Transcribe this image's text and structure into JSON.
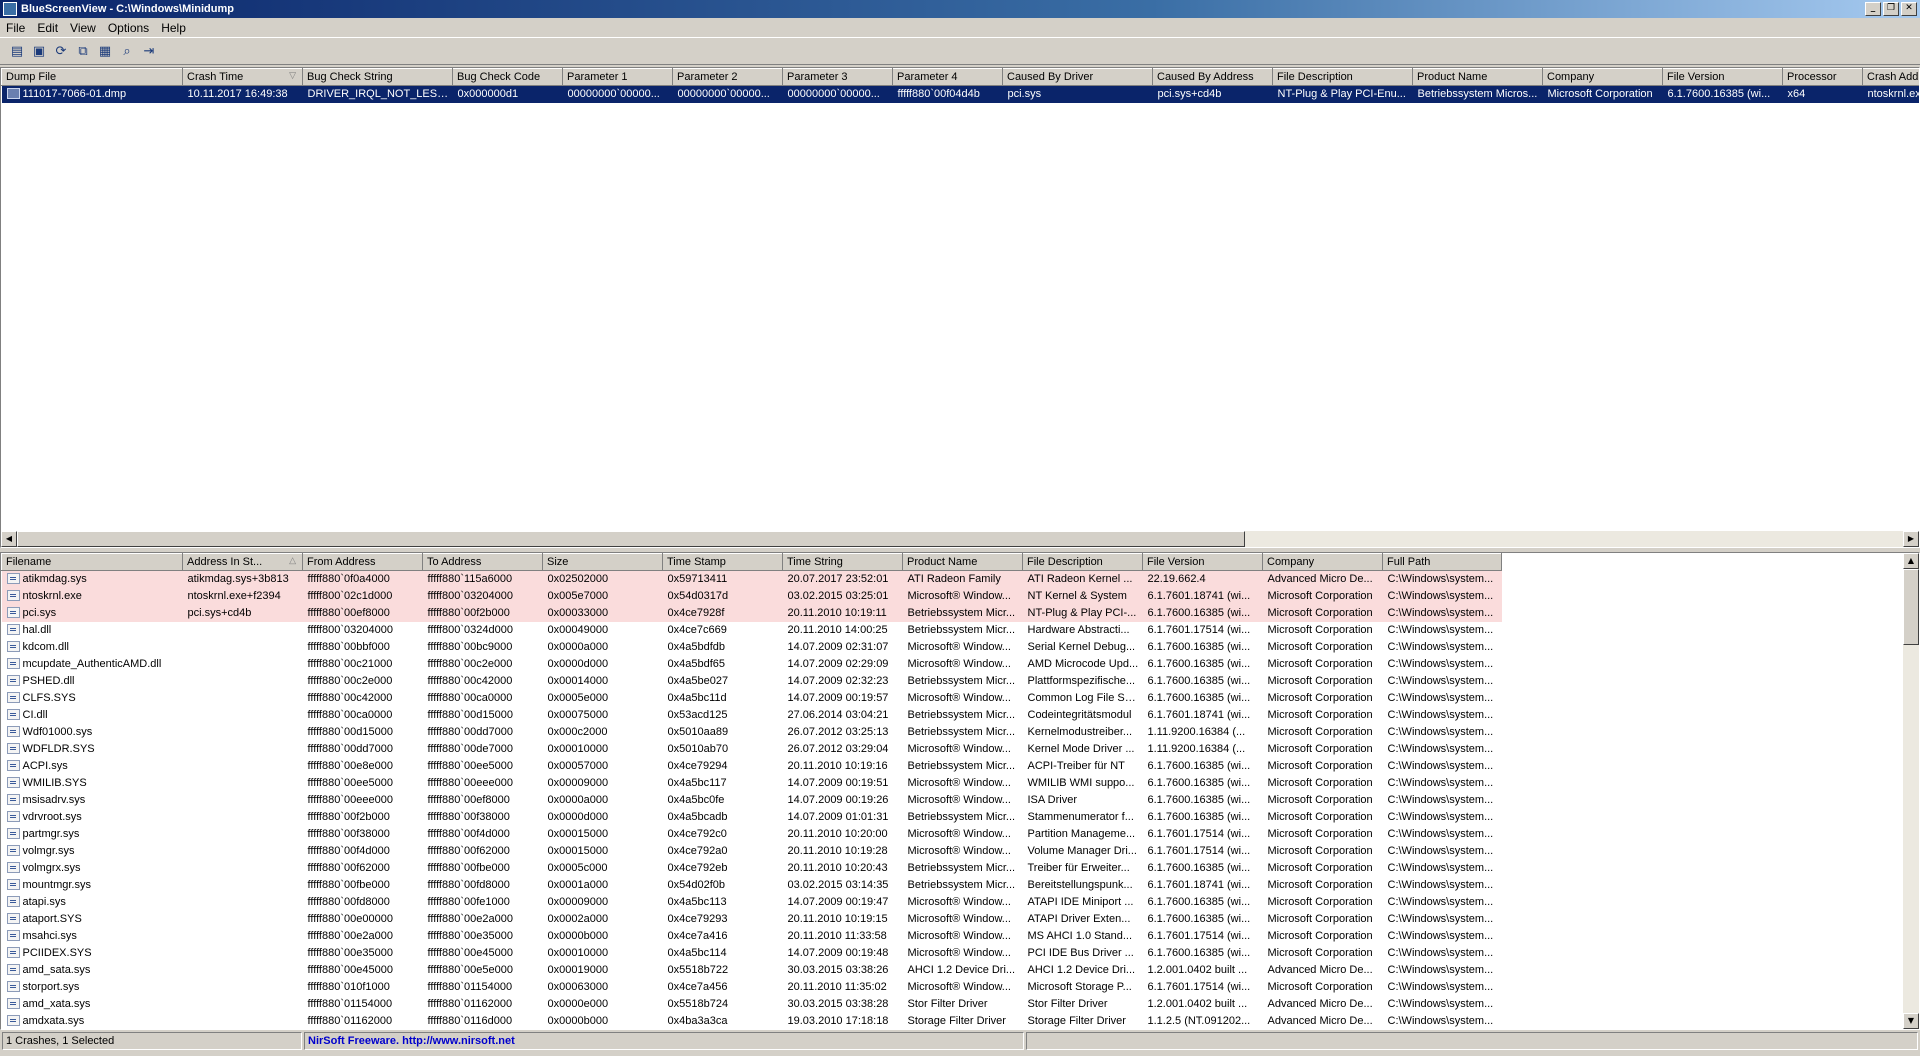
{
  "window": {
    "title": "BlueScreenView  -  C:\\Windows\\Minidump"
  },
  "menu": [
    "File",
    "Edit",
    "View",
    "Options",
    "Help"
  ],
  "toolbar": {
    "icons": [
      "properties-icon",
      "save-icon",
      "refresh-icon",
      "copy-icon",
      "html-report-icon",
      "find-icon",
      "exit-icon"
    ]
  },
  "crash_table": {
    "columns": [
      "Dump File",
      "Crash Time",
      "Bug Check String",
      "Bug Check Code",
      "Parameter 1",
      "Parameter 2",
      "Parameter 3",
      "Parameter 4",
      "Caused By Driver",
      "Caused By Address",
      "File Description",
      "Product Name",
      "Company",
      "File Version",
      "Processor",
      "Crash Addr"
    ],
    "rows": [
      [
        "111017-7066-01.dmp",
        "10.11.2017 16:49:38",
        "DRIVER_IRQL_NOT_LESS...",
        "0x000000d1",
        "00000000`00000...",
        "00000000`00000...",
        "00000000`00000...",
        "fffff880`00f04d4b",
        "pci.sys",
        "pci.sys+cd4b",
        "NT-Plug & Play PCI-Enu...",
        "Betriebssystem Micros...",
        "Microsoft Corporation",
        "6.1.7600.16385 (wi...",
        "x64",
        "ntoskrnl.ex"
      ]
    ]
  },
  "driver_table": {
    "columns": [
      "Filename",
      "Address In St...",
      "From Address",
      "To Address",
      "Size",
      "Time Stamp",
      "Time String",
      "Product Name",
      "File Description",
      "File Version",
      "Company",
      "Full Path"
    ],
    "rows": [
      [
        "atikmdag.sys",
        "atikmdag.sys+3b813",
        "fffff880`0f0a4000",
        "fffff880`115a6000",
        "0x02502000",
        "0x59713411",
        "20.07.2017 23:52:01",
        "ATI Radeon Family",
        "ATI Radeon Kernel ...",
        "22.19.662.4",
        "Advanced Micro De...",
        "C:\\Windows\\system..."
      ],
      [
        "ntoskrnl.exe",
        "ntoskrnl.exe+f2394",
        "fffff800`02c1d000",
        "fffff800`03204000",
        "0x005e7000",
        "0x54d0317d",
        "03.02.2015 03:25:01",
        "Microsoft® Window...",
        "NT Kernel & System",
        "6.1.7601.18741 (wi...",
        "Microsoft Corporation",
        "C:\\Windows\\system..."
      ],
      [
        "pci.sys",
        "pci.sys+cd4b",
        "fffff880`00ef8000",
        "fffff880`00f2b000",
        "0x00033000",
        "0x4ce7928f",
        "20.11.2010 10:19:11",
        "Betriebssystem Micr...",
        "NT-Plug & Play PCI-...",
        "6.1.7600.16385 (wi...",
        "Microsoft Corporation",
        "C:\\Windows\\system..."
      ],
      [
        "hal.dll",
        "",
        "fffff800`03204000",
        "fffff800`0324d000",
        "0x00049000",
        "0x4ce7c669",
        "20.11.2010 14:00:25",
        "Betriebssystem Micr...",
        "Hardware Abstracti...",
        "6.1.7601.17514 (wi...",
        "Microsoft Corporation",
        "C:\\Windows\\system..."
      ],
      [
        "kdcom.dll",
        "",
        "fffff880`00bbf000",
        "fffff880`00bc9000",
        "0x0000a000",
        "0x4a5bdfdb",
        "14.07.2009 02:31:07",
        "Microsoft® Window...",
        "Serial Kernel Debug...",
        "6.1.7600.16385 (wi...",
        "Microsoft Corporation",
        "C:\\Windows\\system..."
      ],
      [
        "mcupdate_AuthenticAMD.dll",
        "",
        "fffff880`00c21000",
        "fffff880`00c2e000",
        "0x0000d000",
        "0x4a5bdf65",
        "14.07.2009 02:29:09",
        "Microsoft® Window...",
        "AMD Microcode Upd...",
        "6.1.7600.16385 (wi...",
        "Microsoft Corporation",
        "C:\\Windows\\system..."
      ],
      [
        "PSHED.dll",
        "",
        "fffff880`00c2e000",
        "fffff880`00c42000",
        "0x00014000",
        "0x4a5be027",
        "14.07.2009 02:32:23",
        "Betriebssystem Micr...",
        "Plattformspezifische...",
        "6.1.7600.16385 (wi...",
        "Microsoft Corporation",
        "C:\\Windows\\system..."
      ],
      [
        "CLFS.SYS",
        "",
        "fffff880`00c42000",
        "fffff880`00ca0000",
        "0x0005e000",
        "0x4a5bc11d",
        "14.07.2009 00:19:57",
        "Microsoft® Window...",
        "Common Log File Sy...",
        "6.1.7600.16385 (wi...",
        "Microsoft Corporation",
        "C:\\Windows\\system..."
      ],
      [
        "CI.dll",
        "",
        "fffff880`00ca0000",
        "fffff880`00d15000",
        "0x00075000",
        "0x53acd125",
        "27.06.2014 03:04:21",
        "Betriebssystem Micr...",
        "Codeintegritätsmodul",
        "6.1.7601.18741 (wi...",
        "Microsoft Corporation",
        "C:\\Windows\\system..."
      ],
      [
        "Wdf01000.sys",
        "",
        "fffff880`00d15000",
        "fffff880`00dd7000",
        "0x000c2000",
        "0x5010aa89",
        "26.07.2012 03:25:13",
        "Betriebssystem Micr...",
        "Kernelmodustreiber...",
        "1.11.9200.16384 (...",
        "Microsoft Corporation",
        "C:\\Windows\\system..."
      ],
      [
        "WDFLDR.SYS",
        "",
        "fffff880`00dd7000",
        "fffff880`00de7000",
        "0x00010000",
        "0x5010ab70",
        "26.07.2012 03:29:04",
        "Microsoft® Window...",
        "Kernel Mode Driver ...",
        "1.11.9200.16384 (...",
        "Microsoft Corporation",
        "C:\\Windows\\system..."
      ],
      [
        "ACPI.sys",
        "",
        "fffff880`00e8e000",
        "fffff880`00ee5000",
        "0x00057000",
        "0x4ce79294",
        "20.11.2010 10:19:16",
        "Betriebssystem Micr...",
        "ACPI-Treiber für NT",
        "6.1.7600.16385 (wi...",
        "Microsoft Corporation",
        "C:\\Windows\\system..."
      ],
      [
        "WMILIB.SYS",
        "",
        "fffff880`00ee5000",
        "fffff880`00eee000",
        "0x00009000",
        "0x4a5bc117",
        "14.07.2009 00:19:51",
        "Microsoft® Window...",
        "WMILIB WMI suppo...",
        "6.1.7600.16385 (wi...",
        "Microsoft Corporation",
        "C:\\Windows\\system..."
      ],
      [
        "msisadrv.sys",
        "",
        "fffff880`00eee000",
        "fffff880`00ef8000",
        "0x0000a000",
        "0x4a5bc0fe",
        "14.07.2009 00:19:26",
        "Microsoft® Window...",
        "ISA Driver",
        "6.1.7600.16385 (wi...",
        "Microsoft Corporation",
        "C:\\Windows\\system..."
      ],
      [
        "vdrvroot.sys",
        "",
        "fffff880`00f2b000",
        "fffff880`00f38000",
        "0x0000d000",
        "0x4a5bcadb",
        "14.07.2009 01:01:31",
        "Betriebssystem Micr...",
        "Stammenumerator f...",
        "6.1.7600.16385 (wi...",
        "Microsoft Corporation",
        "C:\\Windows\\system..."
      ],
      [
        "partmgr.sys",
        "",
        "fffff880`00f38000",
        "fffff880`00f4d000",
        "0x00015000",
        "0x4ce792c0",
        "20.11.2010 10:20:00",
        "Microsoft® Window...",
        "Partition Manageme...",
        "6.1.7601.17514 (wi...",
        "Microsoft Corporation",
        "C:\\Windows\\system..."
      ],
      [
        "volmgr.sys",
        "",
        "fffff880`00f4d000",
        "fffff880`00f62000",
        "0x00015000",
        "0x4ce792a0",
        "20.11.2010 10:19:28",
        "Microsoft® Window...",
        "Volume Manager Dri...",
        "6.1.7601.17514 (wi...",
        "Microsoft Corporation",
        "C:\\Windows\\system..."
      ],
      [
        "volmgrx.sys",
        "",
        "fffff880`00f62000",
        "fffff880`00fbe000",
        "0x0005c000",
        "0x4ce792eb",
        "20.11.2010 10:20:43",
        "Betriebssystem Micr...",
        "Treiber für Erweiter...",
        "6.1.7600.16385 (wi...",
        "Microsoft Corporation",
        "C:\\Windows\\system..."
      ],
      [
        "mountmgr.sys",
        "",
        "fffff880`00fbe000",
        "fffff880`00fd8000",
        "0x0001a000",
        "0x54d02f0b",
        "03.02.2015 03:14:35",
        "Betriebssystem Micr...",
        "Bereitstellungspunk...",
        "6.1.7601.18741 (wi...",
        "Microsoft Corporation",
        "C:\\Windows\\system..."
      ],
      [
        "atapi.sys",
        "",
        "fffff880`00fd8000",
        "fffff880`00fe1000",
        "0x00009000",
        "0x4a5bc113",
        "14.07.2009 00:19:47",
        "Microsoft® Window...",
        "ATAPI IDE Miniport ...",
        "6.1.7600.16385 (wi...",
        "Microsoft Corporation",
        "C:\\Windows\\system..."
      ],
      [
        "ataport.SYS",
        "",
        "fffff880`00e00000",
        "fffff880`00e2a000",
        "0x0002a000",
        "0x4ce79293",
        "20.11.2010 10:19:15",
        "Microsoft® Window...",
        "ATAPI Driver Exten...",
        "6.1.7600.16385 (wi...",
        "Microsoft Corporation",
        "C:\\Windows\\system..."
      ],
      [
        "msahci.sys",
        "",
        "fffff880`00e2a000",
        "fffff880`00e35000",
        "0x0000b000",
        "0x4ce7a416",
        "20.11.2010 11:33:58",
        "Microsoft® Window...",
        "MS AHCI 1.0 Stand...",
        "6.1.7601.17514 (wi...",
        "Microsoft Corporation",
        "C:\\Windows\\system..."
      ],
      [
        "PCIIDEX.SYS",
        "",
        "fffff880`00e35000",
        "fffff880`00e45000",
        "0x00010000",
        "0x4a5bc114",
        "14.07.2009 00:19:48",
        "Microsoft® Window...",
        "PCI IDE Bus Driver ...",
        "6.1.7600.16385 (wi...",
        "Microsoft Corporation",
        "C:\\Windows\\system..."
      ],
      [
        "amd_sata.sys",
        "",
        "fffff880`00e45000",
        "fffff880`00e5e000",
        "0x00019000",
        "0x5518b722",
        "30.03.2015 03:38:26",
        "AHCI 1.2 Device Dri...",
        "AHCI 1.2 Device Dri...",
        "1.2.001.0402 built ...",
        "Advanced Micro De...",
        "C:\\Windows\\system..."
      ],
      [
        "storport.sys",
        "",
        "fffff880`010f1000",
        "fffff880`01154000",
        "0x00063000",
        "0x4ce7a456",
        "20.11.2010 11:35:02",
        "Microsoft® Window...",
        "Microsoft Storage P...",
        "6.1.7601.17514 (wi...",
        "Microsoft Corporation",
        "C:\\Windows\\system..."
      ],
      [
        "amd_xata.sys",
        "",
        "fffff880`01154000",
        "fffff880`01162000",
        "0x0000e000",
        "0x5518b724",
        "30.03.2015 03:38:28",
        "Stor Filter Driver",
        "Stor Filter Driver",
        "1.2.001.0402 built ...",
        "Advanced Micro De...",
        "C:\\Windows\\system..."
      ],
      [
        "amdxata.sys",
        "",
        "fffff880`01162000",
        "fffff880`0116d000",
        "0x0000b000",
        "0x4ba3a3ca",
        "19.03.2010 17:18:18",
        "Storage Filter Driver",
        "Storage Filter Driver",
        "1.1.2.5 (NT.091202...",
        "Advanced Micro De...",
        "C:\\Windows\\system..."
      ]
    ],
    "highlighted_rows": 3,
    "highlight_color": "#fadcdc"
  },
  "status": {
    "count": "1 Crashes, 1 Selected",
    "freeware": "NirSoft Freeware.  http://www.nirsoft.net"
  },
  "colors": {
    "selection": "#0a246a",
    "title_start": "#0a246a",
    "title_end": "#a6caf0"
  }
}
